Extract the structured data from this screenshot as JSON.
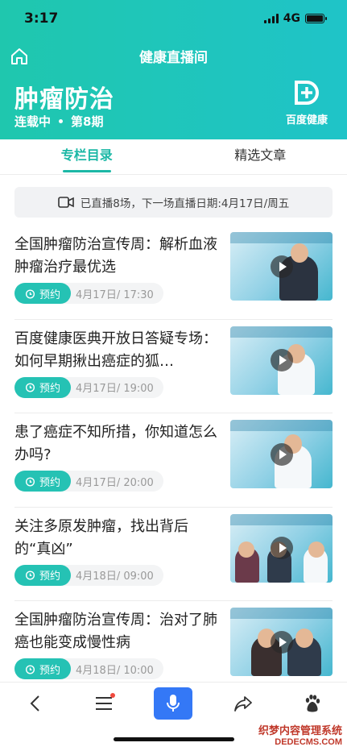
{
  "status": {
    "time": "3:17",
    "network": "4G"
  },
  "header": {
    "title": "健康直播间",
    "column_title": "肿瘤防治",
    "status_text": "连载中",
    "episode": "第8期",
    "brand": "百度健康"
  },
  "tabs": [
    {
      "label": "专栏目录",
      "active": true
    },
    {
      "label": "精选文章",
      "active": false
    }
  ],
  "live_banner": {
    "text": "已直播8场，下一场直播日期:4月17日/周五"
  },
  "articles": [
    {
      "title": "全国肿瘤防治宣传周：解析血液肿瘤治疗最优选",
      "button": "预约",
      "date": "4月17日/ 17:30"
    },
    {
      "title": "百度健康医典开放日答疑专场：如何早期揪出癌症的狐…",
      "button": "预约",
      "date": "4月17日/ 19:00"
    },
    {
      "title": "患了癌症不知所措，你知道怎么办吗?",
      "button": "预约",
      "date": "4月17日/ 20:00"
    },
    {
      "title": "关注多原发肿瘤，找出背后的“真凶”",
      "button": "预约",
      "date": "4月18日/ 09:00"
    },
    {
      "title": "全国肿瘤防治宣传周：治对了肺癌也能变成慢性病",
      "button": "预约",
      "date": "4月18日/ 10:00"
    }
  ],
  "watermark": {
    "line1": "织梦内容管理系统",
    "line2": "DEDECMS.COM"
  },
  "colors": {
    "brand_teal": "#1fc7ae",
    "accent": "#1cb8a6",
    "mic_blue": "#3478f6"
  }
}
